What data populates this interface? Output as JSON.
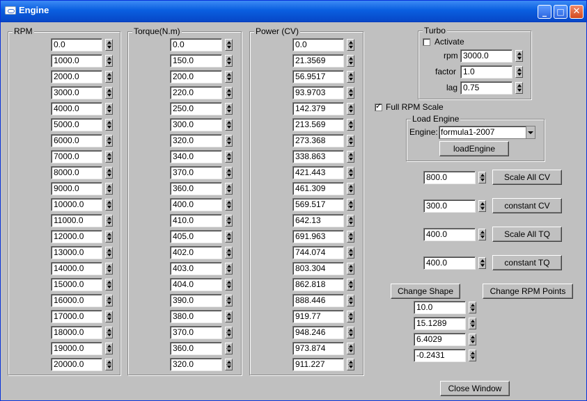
{
  "window": {
    "title": "Engine"
  },
  "rpm_group": {
    "legend": "RPM",
    "values": [
      "0.0",
      "1000.0",
      "2000.0",
      "3000.0",
      "4000.0",
      "5000.0",
      "6000.0",
      "7000.0",
      "8000.0",
      "9000.0",
      "10000.0",
      "11000.0",
      "12000.0",
      "13000.0",
      "14000.0",
      "15000.0",
      "16000.0",
      "17000.0",
      "18000.0",
      "19000.0",
      "20000.0"
    ]
  },
  "torque_group": {
    "legend": "Torque(N.m)",
    "values": [
      "0.0",
      "150.0",
      "200.0",
      "220.0",
      "250.0",
      "300.0",
      "320.0",
      "340.0",
      "370.0",
      "360.0",
      "400.0",
      "410.0",
      "405.0",
      "402.0",
      "403.0",
      "404.0",
      "390.0",
      "380.0",
      "370.0",
      "360.0",
      "320.0"
    ]
  },
  "power_group": {
    "legend": "Power (CV)",
    "values": [
      "0.0",
      "21.3569",
      "56.9517",
      "93.9703",
      "142.379",
      "213.569",
      "273.368",
      "338.863",
      "421.443",
      "461.309",
      "569.517",
      "642.13",
      "691.963",
      "744.074",
      "803.304",
      "862.818",
      "888.446",
      "919.77",
      "948.246",
      "973.874",
      "911.227"
    ]
  },
  "turbo": {
    "legend": "Turbo",
    "activate_label": "Activate",
    "activate_checked": false,
    "rpm_label": "rpm",
    "rpm_value": "3000.0",
    "factor_label": "factor",
    "factor_value": "1.0",
    "lag_label": "lag",
    "lag_value": "0.75"
  },
  "full_rpm_scale": {
    "label": "Full RPM Scale",
    "checked": true
  },
  "load_engine": {
    "legend": "Load Engine",
    "engine_label": "Engine:",
    "engine_selected": "formula1-2007",
    "load_button": "loadEngine"
  },
  "scaling": {
    "scale_cv_value": "800.0",
    "scale_cv_button": "Scale All CV",
    "const_cv_value": "300.0",
    "const_cv_button": "constant CV",
    "scale_tq_value": "400.0",
    "scale_tq_button": "Scale All TQ",
    "const_tq_value": "400.0",
    "const_tq_button": "constant TQ"
  },
  "shape": {
    "change_shape_button": "Change Shape",
    "change_rpm_button": "Change RPM Points",
    "values": [
      "10.0",
      "15.1289",
      "6.4029",
      "-0.2431"
    ]
  },
  "close_button": "Close Window"
}
